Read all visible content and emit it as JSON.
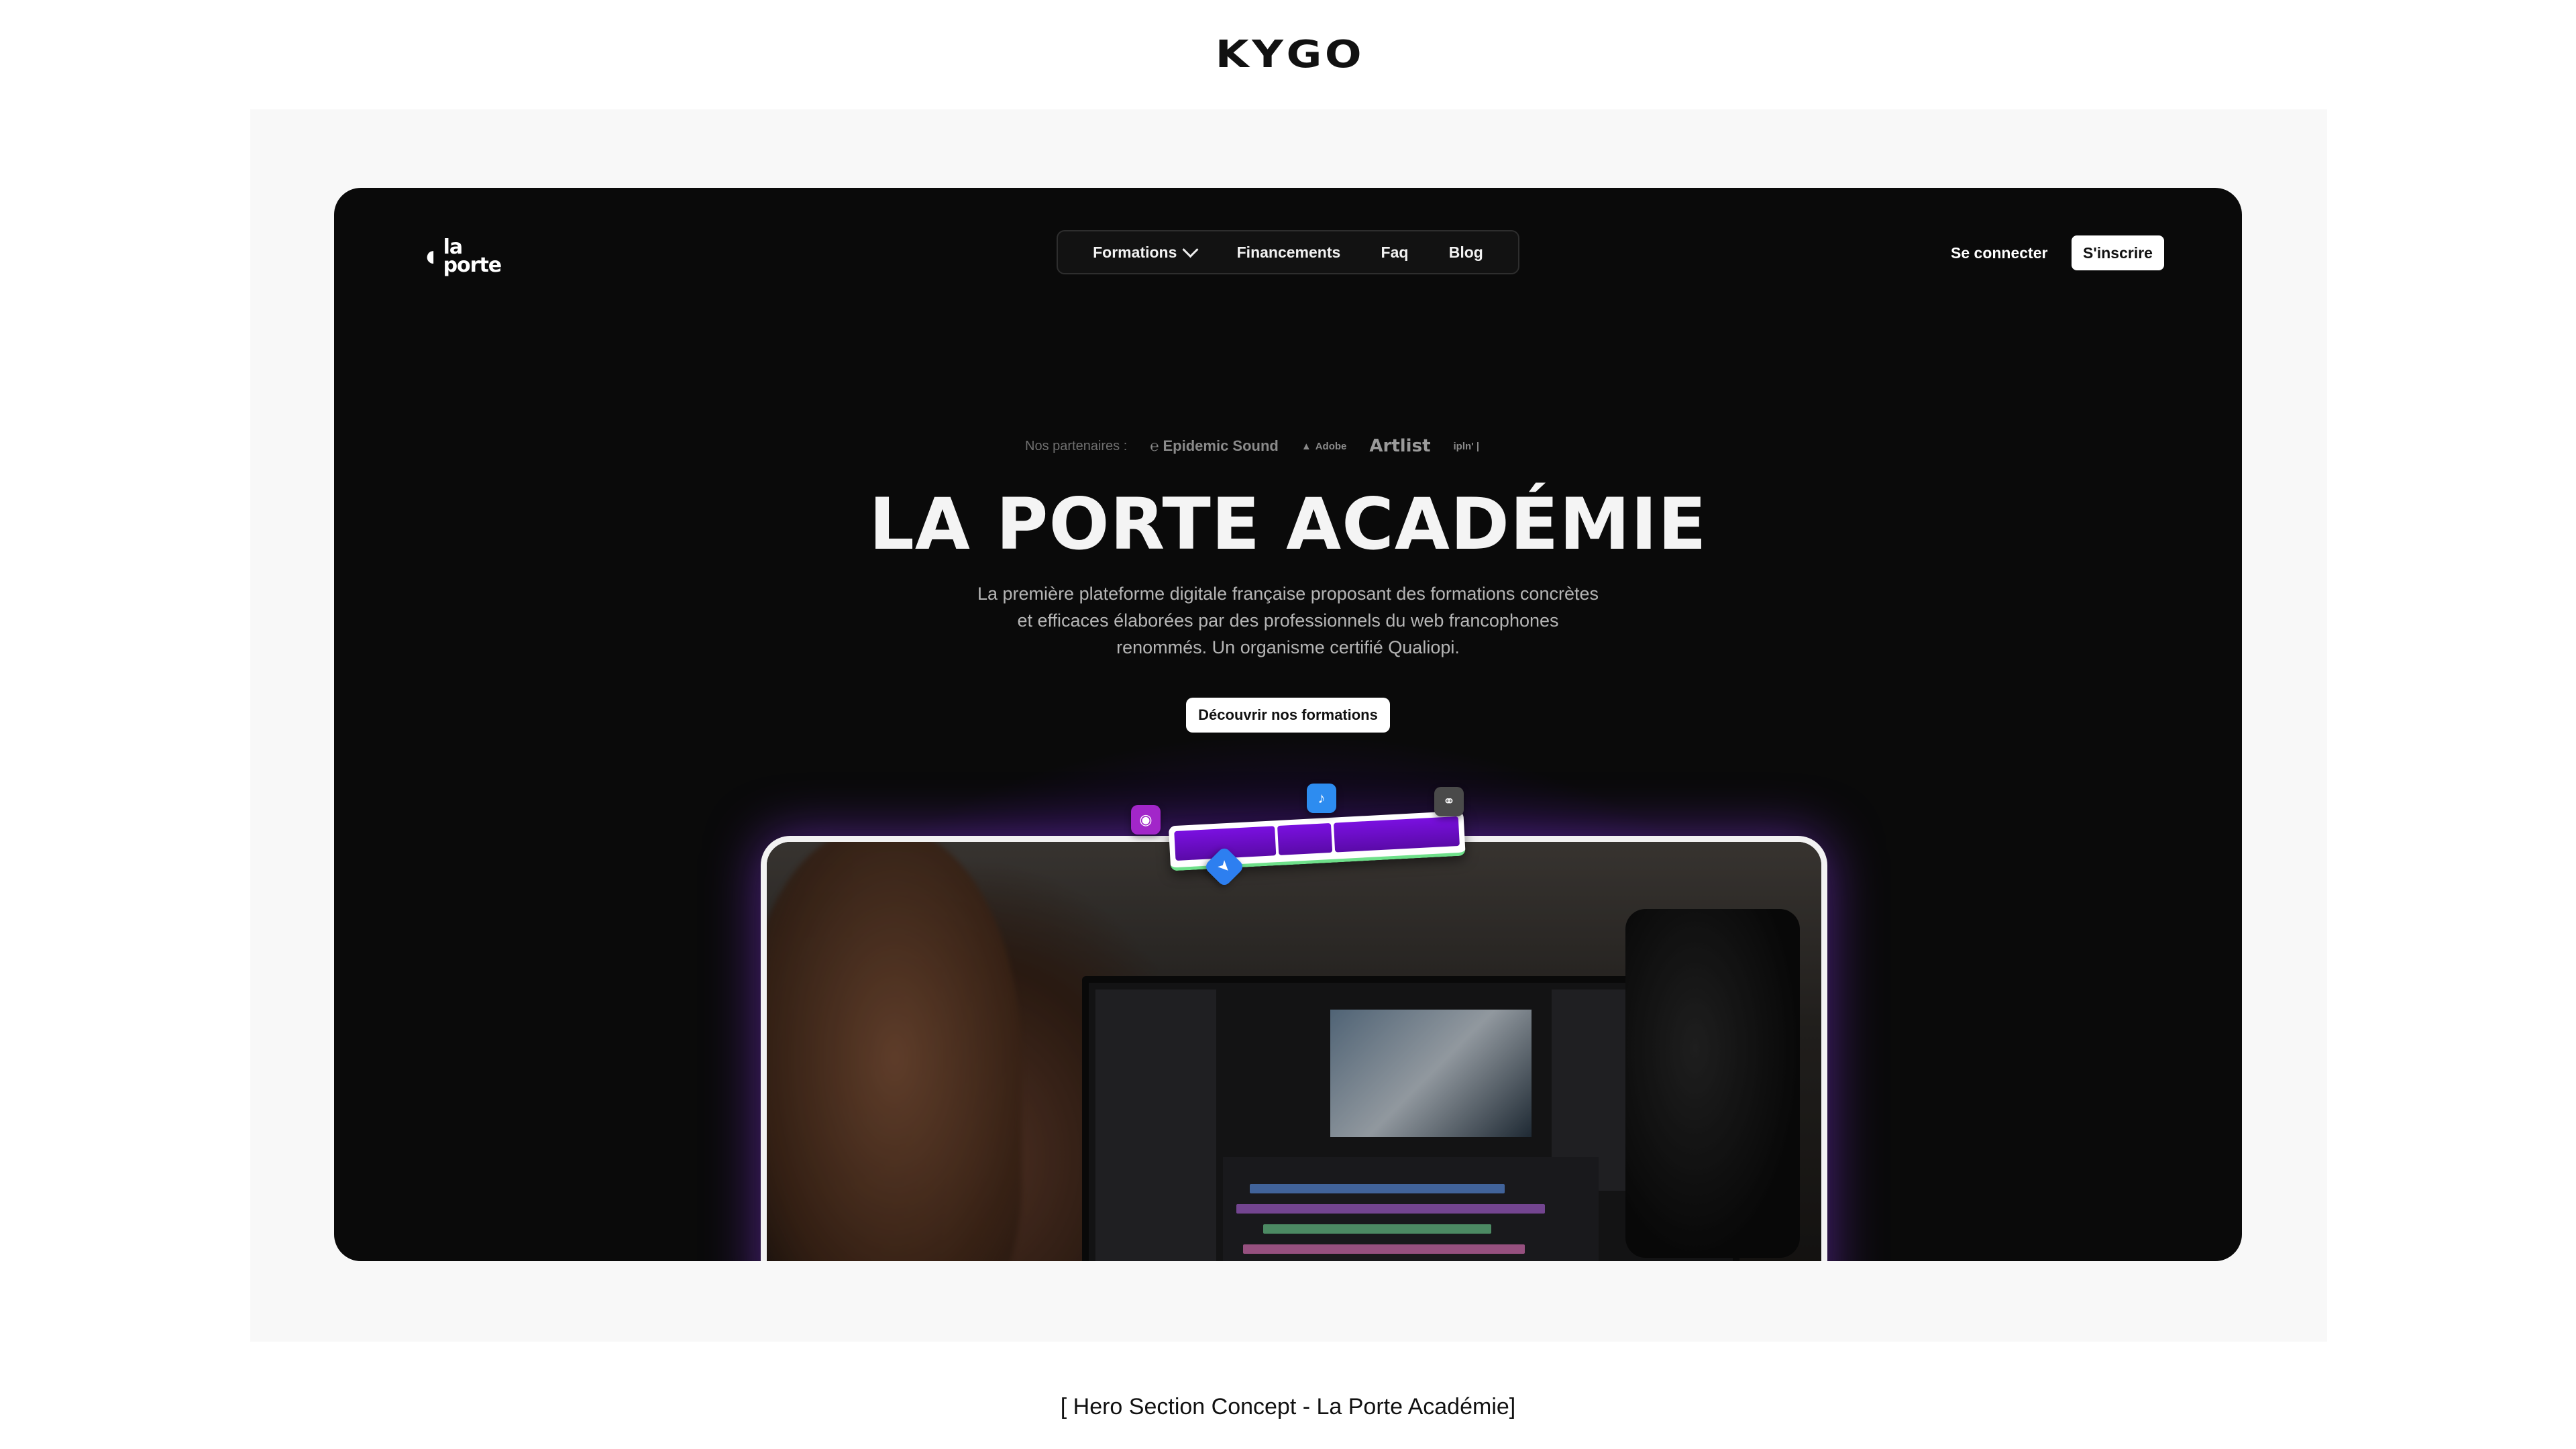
{
  "brand": {
    "logo": "KYGO"
  },
  "site": {
    "logo_top": "la",
    "logo_bottom": "porte",
    "nav": [
      "Formations",
      "Financements",
      "Faq",
      "Blog"
    ],
    "login": "Se connecter",
    "signup": "S'inscrire"
  },
  "partners": {
    "label": "Nos partenaires :",
    "items": [
      "Epidemic Sound",
      "Adobe",
      "Artlist",
      "ipln' |"
    ]
  },
  "hero": {
    "title": "LA PORTE ACADÉMIE",
    "subtitle": "La première plateforme digitale française proposant des formations concrètes et efficaces élaborées par des professionnels du web francophones renommés. Un organisme certifié Qualiopi.",
    "cta": "Découvrir nos formations"
  },
  "caption": "[ Hero Section Concept - La Porte Académie]",
  "colors": {
    "accent_purple": "#6e18e6",
    "frame_bg": "#0a0a0a",
    "board_bg": "#f8f8f8"
  }
}
